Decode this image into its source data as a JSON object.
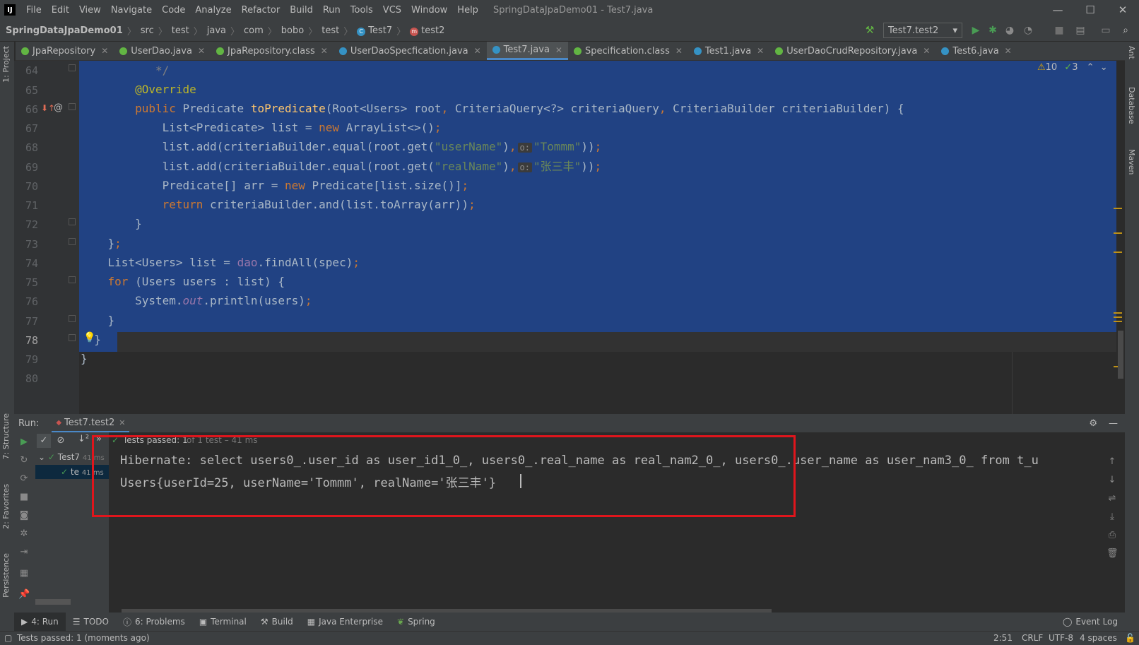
{
  "window": {
    "title": "SpringDataJpaDemo01 - Test7.java",
    "menu": [
      "File",
      "Edit",
      "View",
      "Navigate",
      "Code",
      "Analyze",
      "Refactor",
      "Build",
      "Run",
      "Tools",
      "VCS",
      "Window",
      "Help"
    ],
    "controls": {
      "minimize": "—",
      "maximize": "☐",
      "close": "✕"
    }
  },
  "breadcrumb": [
    "SpringDataJpaDemo01",
    "src",
    "test",
    "java",
    "com",
    "bobo",
    "test",
    "Test7",
    "test2"
  ],
  "run_config": "Test7.test2",
  "tabs": [
    {
      "label": "JpaRepository",
      "icon": "interface-icon",
      "color": "#62b543"
    },
    {
      "label": "UserDao.java",
      "icon": "interface-icon",
      "color": "#62b543"
    },
    {
      "label": "JpaRepository.class",
      "icon": "interface-icon",
      "color": "#62b543"
    },
    {
      "label": "UserDaoSpecfication.java",
      "icon": "class-icon",
      "color": "#3592c4"
    },
    {
      "label": "Test7.java",
      "icon": "class-icon",
      "color": "#3592c4",
      "active": true
    },
    {
      "label": "Specification.class",
      "icon": "interface-icon",
      "color": "#62b543"
    },
    {
      "label": "Test1.java",
      "icon": "class-icon",
      "color": "#3592c4"
    },
    {
      "label": "UserDaoCrudRepository.java",
      "icon": "interface-icon",
      "color": "#62b543"
    },
    {
      "label": "Test6.java",
      "icon": "class-icon",
      "color": "#3592c4"
    }
  ],
  "inspections": {
    "warnings": "10",
    "weak_warnings": "3"
  },
  "editor": {
    "line_numbers": [
      "64",
      "65",
      "66",
      "67",
      "68",
      "69",
      "70",
      "71",
      "72",
      "73",
      "74",
      "75",
      "76",
      "77",
      "78",
      "79",
      "80"
    ],
    "hint_o": "o:",
    "str_tommm": "\"Tommm\"",
    "str_zhang": "\"张三丰\"",
    "str_userName": "\"userName\"",
    "str_realName": "\"realName\""
  },
  "left_tools": [
    "1: Project",
    "7: Structure",
    "2: Favorites",
    "Persistence"
  ],
  "right_tools": [
    "Ant",
    "Database",
    "Maven"
  ],
  "run_panel": {
    "label": "Run:",
    "tab": "Test7.test2",
    "status": "Tests passed: 1",
    "status_detail": "of 1 test – 41 ms",
    "tree": [
      {
        "label": "Test7",
        "time": "41 ms"
      },
      {
        "label": "te",
        "time": "41 ms"
      }
    ],
    "console": [
      "Hibernate: select users0_.user_id as user_id1_0_, users0_.real_name as real_nam2_0_, users0_.user_name as user_nam3_0_ from t_u",
      "Users{userId=25, userName='Tommm', realName='张三丰'}"
    ]
  },
  "bottom_tabs": [
    {
      "label": "4: Run",
      "active": true
    },
    {
      "label": "TODO"
    },
    {
      "label": "6: Problems"
    },
    {
      "label": "Terminal"
    },
    {
      "label": "Build"
    },
    {
      "label": "Java Enterprise"
    },
    {
      "label": "Spring"
    }
  ],
  "event_log": "Event Log",
  "status_bar": {
    "message": "Tests passed: 1 (moments ago)",
    "position": "2:51",
    "line_sep": "CRLF",
    "encoding": "UTF-8",
    "indent": "4 spaces"
  }
}
